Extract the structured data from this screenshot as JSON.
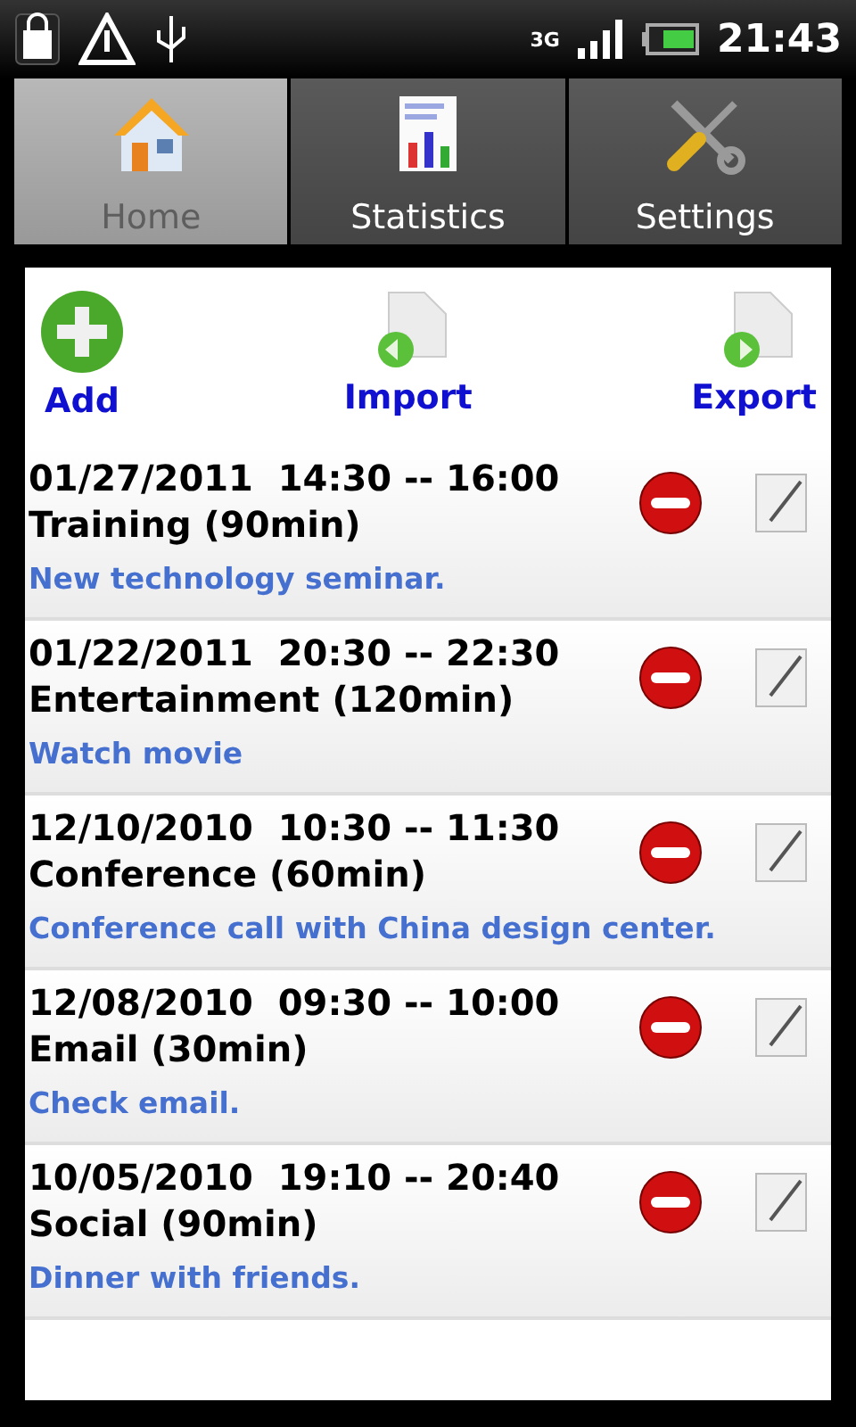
{
  "status_bar": {
    "time": "21:43",
    "network": "3G"
  },
  "tabs": [
    {
      "label": "Home",
      "selected": true,
      "kind": "home"
    },
    {
      "label": "Statistics",
      "selected": false,
      "kind": "stats"
    },
    {
      "label": "Settings",
      "selected": false,
      "kind": "settings"
    }
  ],
  "actions": [
    {
      "label": "Add",
      "kind": "add"
    },
    {
      "label": "Import",
      "kind": "import"
    },
    {
      "label": "Export",
      "kind": "export"
    }
  ],
  "events": [
    {
      "date": "01/27/2011",
      "time": "14:30 -- 16:00",
      "title": "Training (90min)",
      "note": "New technology seminar."
    },
    {
      "date": "01/22/2011",
      "time": "20:30 -- 22:30",
      "title": "Entertainment (120min)",
      "note": "Watch movie"
    },
    {
      "date": "12/10/2010",
      "time": "10:30 -- 11:30",
      "title": "Conference (60min)",
      "note": "Conference call with China design center."
    },
    {
      "date": "12/08/2010",
      "time": "09:30 -- 10:00",
      "title": "Email (30min)",
      "note": "Check email."
    },
    {
      "date": "10/05/2010",
      "time": "19:10 -- 20:40",
      "title": "Social (90min)",
      "note": "Dinner with friends."
    }
  ]
}
